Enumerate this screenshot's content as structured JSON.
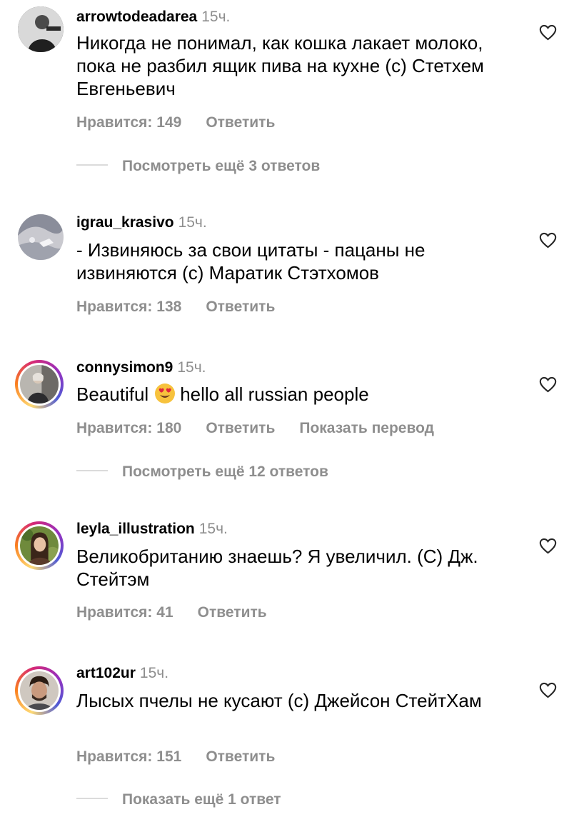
{
  "comments": [
    {
      "username": "arrowtodeadarea",
      "time": "15ч.",
      "text": "Никогда не понимал, как кошка лакает молоко, пока не разбил ящик пива на кухне (с) Стетхем Евгеньевич",
      "likes_label": "Нравится: 149",
      "reply_label": "Ответить",
      "view_more": "Посмотреть ещё 3 ответов"
    },
    {
      "username": "igrau_krasivo",
      "time": "15ч.",
      "text": "- Извиняюсь за свои цитаты - пацаны не извиняются (с) Маратик Стэтхомов",
      "likes_label": "Нравится: 138",
      "reply_label": "Ответить"
    },
    {
      "username": "connysimon9",
      "time": "15ч.",
      "text_before": "Beautiful",
      "emoji": "smiling-face-with-heart-eyes",
      "text_after": "hello all russian people",
      "likes_label": "Нравится: 180",
      "reply_label": "Ответить",
      "translate_label": "Показать перевод",
      "view_more": "Посмотреть ещё 12 ответов"
    },
    {
      "username": "leyla_illustration",
      "time": "15ч.",
      "text": "Великобританию знаешь? Я увеличил. (С) Дж. Стейтэм",
      "likes_label": "Нравится: 41",
      "reply_label": "Ответить"
    },
    {
      "username": "art102ur",
      "time": "15ч.",
      "text": "Лысых пчелы не кусают (с) Джейсон СтейтХам",
      "likes_label": "Нравится: 151",
      "reply_label": "Ответить",
      "view_more": "Показать ещё 1 ответ"
    }
  ],
  "icons": {
    "like": "heart-outline-icon"
  },
  "colors": {
    "muted_text": "#8e8e8e",
    "story_ring": [
      "#feda75",
      "#fa7e1e",
      "#d62976",
      "#962fbf",
      "#4f5bd5"
    ]
  }
}
